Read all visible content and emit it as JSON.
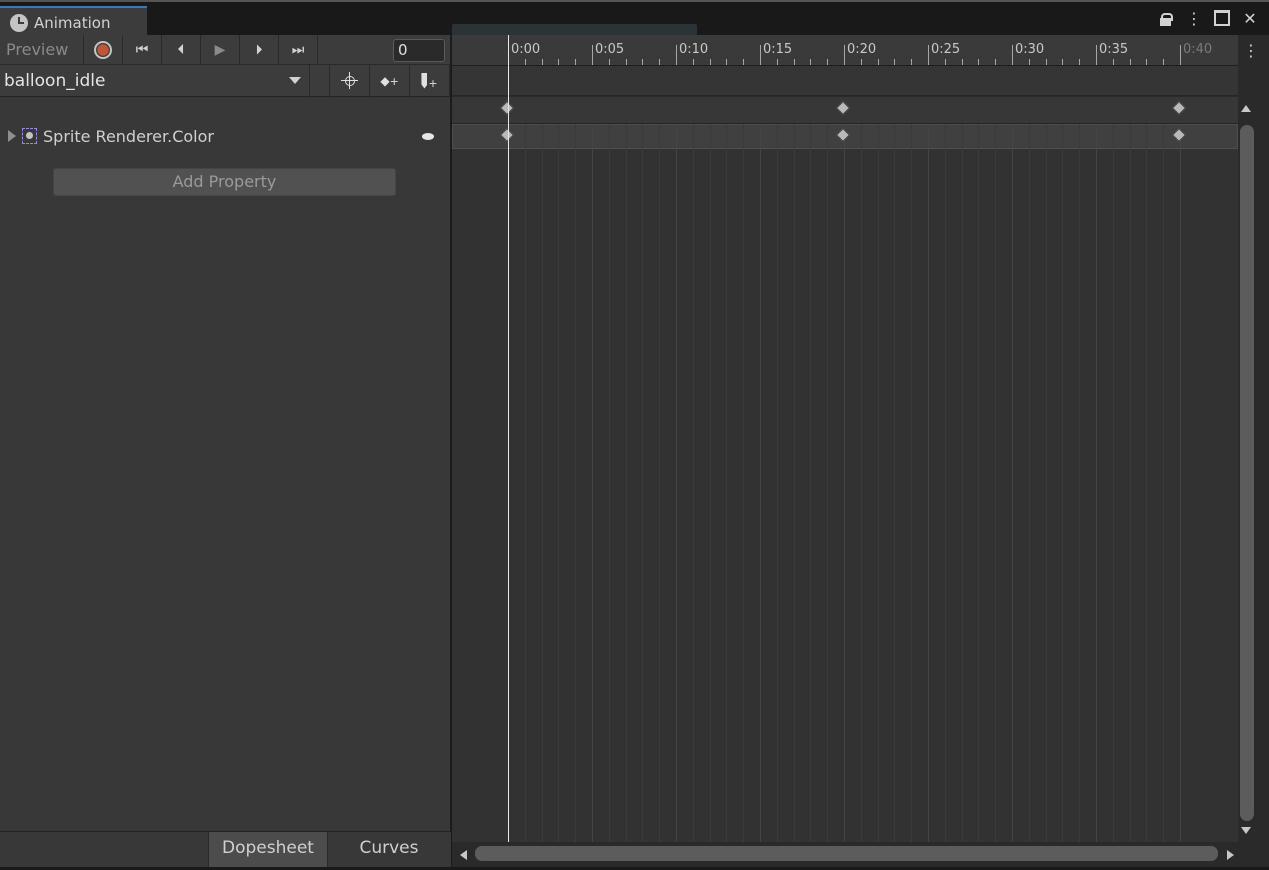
{
  "window": {
    "tab_title": "Animation",
    "tab_icon": "clock-icon"
  },
  "toolbar": {
    "preview_label": "Preview",
    "record_icon": "record-icon",
    "first_key_icon": "skip-to-start-icon",
    "prev_key_icon": "previous-keyframe-icon",
    "play_icon": "play-icon",
    "next_key_icon": "next-keyframe-icon",
    "last_key_icon": "skip-to-end-icon",
    "frame_value": "0"
  },
  "clip": {
    "selected": "balloon_idle",
    "filter_icon": "filter-by-selection-icon",
    "add_keyframe_icon": "add-keyframe-icon",
    "add_event_icon": "add-event-icon"
  },
  "properties": [
    {
      "label": "Sprite Renderer.Color",
      "icon": "sprite-renderer-icon"
    }
  ],
  "add_property_label": "Add Property",
  "view_tabs": {
    "dopesheet": "Dopesheet",
    "curves": "Curves",
    "active": "Dopesheet"
  },
  "timeline": {
    "ticks": [
      "0:00",
      "0:05",
      "0:10",
      "0:15",
      "0:20",
      "0:25",
      "0:30",
      "0:35",
      "0:40"
    ],
    "current_time": "0:00",
    "keyframe_times": [
      "0:00",
      "0:20",
      "0:40"
    ]
  },
  "colors": {
    "panel": "#383838",
    "timeline_bg": "#323232",
    "accent_tab": "#3a79bb",
    "record": "#c0553a",
    "keyframe": "#b9b9b9"
  }
}
